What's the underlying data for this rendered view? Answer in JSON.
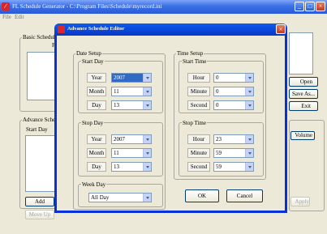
{
  "app": {
    "title": "FL Schedule Generator - C:\\Program Files\\Schedule\\myrecord.ini",
    "menu": [
      "File",
      "Edit"
    ],
    "basic_group": "Basic Schedule",
    "basic_col": "File",
    "advance_group": "Advance Schedule",
    "advance_col": "Start Day",
    "buttons": {
      "open": "Open",
      "save_as": "Save As...",
      "exit": "Exit",
      "volume": "Volume",
      "add": "Add",
      "move_up": "Move Up",
      "apply": "Apply"
    }
  },
  "dialog": {
    "title": "Advance Schedule Editor",
    "close_glyph": "×",
    "date_setup": "Date Setup",
    "time_setup": "Time Setup",
    "start_day": {
      "label": "Start Day",
      "year_label": "Year",
      "year": "2007",
      "month_label": "Month",
      "month": "11",
      "day_label": "Day",
      "day": "13"
    },
    "stop_day": {
      "label": "Stop Day",
      "year_label": "Year",
      "year": "2007",
      "month_label": "Month",
      "month": "11",
      "day_label": "Day",
      "day": "13"
    },
    "start_time": {
      "label": "Start Time",
      "hour_label": "Hour",
      "hour": "0",
      "minute_label": "Minute",
      "minute": "0",
      "second_label": "Second",
      "second": "0"
    },
    "stop_time": {
      "label": "Stop Time",
      "hour_label": "Hour",
      "hour": "23",
      "minute_label": "Minute",
      "minute": "59",
      "second_label": "Second",
      "second": "59"
    },
    "week_day": {
      "label": "Week Day",
      "value": "All Day"
    },
    "ok": "OK",
    "cancel": "Cancel"
  }
}
